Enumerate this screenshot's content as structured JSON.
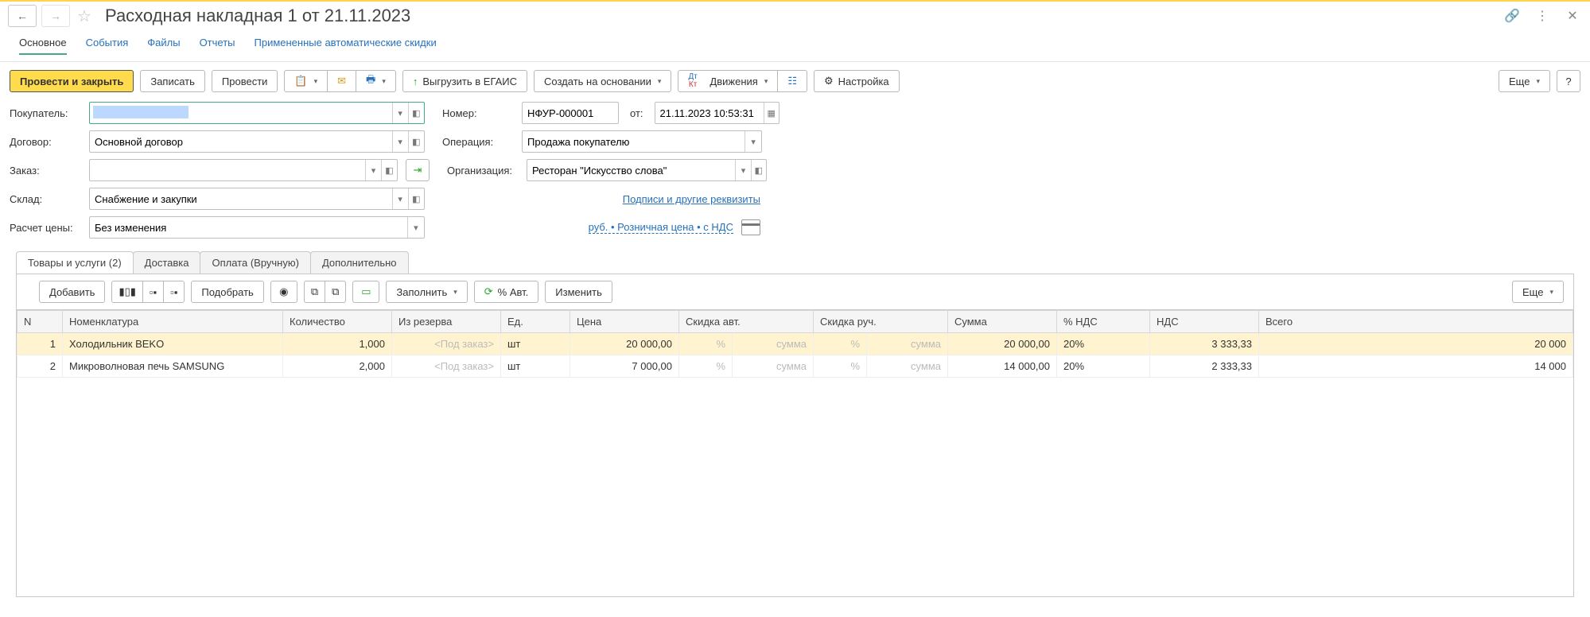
{
  "title": "Расходная накладная 1 от 21.11.2023",
  "nav_tabs": {
    "main": "Основное",
    "events": "События",
    "files": "Файлы",
    "reports": "Отчеты",
    "discounts": "Примененные автоматические скидки"
  },
  "toolbar": {
    "post_close": "Провести и закрыть",
    "save": "Записать",
    "post": "Провести",
    "egais": "Выгрузить в ЕГАИС",
    "create_based": "Создать на основании",
    "movements": "Движения",
    "settings": "Настройка",
    "more": "Еще"
  },
  "form": {
    "buyer_label": "Покупатель:",
    "buyer_value": "",
    "contract_label": "Договор:",
    "contract_value": "Основной договор",
    "order_label": "Заказ:",
    "order_value": "",
    "warehouse_label": "Склад:",
    "warehouse_value": "Снабжение и закупки",
    "price_calc_label": "Расчет цены:",
    "price_calc_value": "Без изменения",
    "number_label": "Номер:",
    "number_value": "НФУР-000001",
    "from_label": "от:",
    "date_value": "21.11.2023 10:53:31",
    "operation_label": "Операция:",
    "operation_value": "Продажа покупателю",
    "org_label": "Организация:",
    "org_value": "Ресторан \"Искусство слова\"",
    "sign_link": "Подписи и другие реквизиты",
    "price_link": "руб. • Розничная цена • с НДС"
  },
  "tabs": {
    "goods": "Товары и услуги (2)",
    "delivery": "Доставка",
    "payment": "Оплата (Вручную)",
    "extra": "Дополнительно"
  },
  "subtool": {
    "add": "Добавить",
    "pick": "Подобрать",
    "fill": "Заполнить",
    "pct": "% Авт.",
    "change": "Изменить",
    "more": "Еще"
  },
  "columns": {
    "n": "N",
    "nom": "Номенклатура",
    "qty": "Количество",
    "reserve": "Из резерва",
    "unit": "Ед.",
    "price": "Цена",
    "disc_auto": "Скидка авт.",
    "disc_man": "Скидка руч.",
    "sum": "Сумма",
    "vat_pct": "% НДС",
    "vat": "НДС",
    "total": "Всего"
  },
  "reserve_ph": "<Под заказ>",
  "pct_ph": "%",
  "sum_ph": "сумма",
  "rows": [
    {
      "n": "1",
      "nom": "Холодильник BEKO",
      "qty": "1,000",
      "unit": "шт",
      "price": "20 000,00",
      "sum": "20 000,00",
      "vat_pct": "20%",
      "vat": "3 333,33",
      "total": "20 000"
    },
    {
      "n": "2",
      "nom": "Микроволновая печь SAMSUNG",
      "qty": "2,000",
      "unit": "шт",
      "price": "7 000,00",
      "sum": "14 000,00",
      "vat_pct": "20%",
      "vat": "2 333,33",
      "total": "14 000"
    }
  ]
}
